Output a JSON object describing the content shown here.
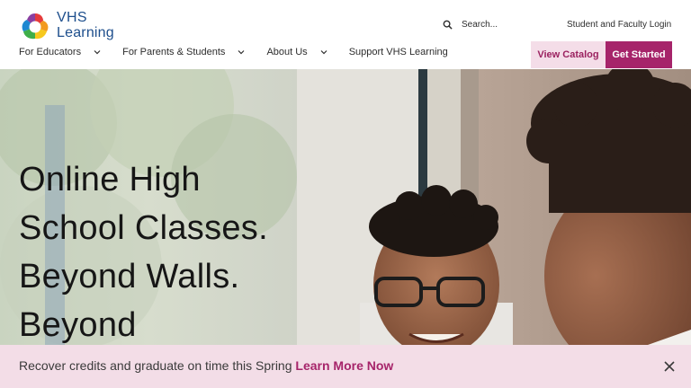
{
  "brand": {
    "name_line1": "VHS",
    "name_line2": "Learning",
    "colors": {
      "primary": "#1d4e8c",
      "accent": "#a6246a",
      "accent_light": "#f4dde8"
    }
  },
  "header": {
    "search_placeholder": "Search...",
    "search_icon": "search-icon",
    "login_label": "Student and Faculty Login",
    "nav": [
      {
        "label": "For Educators",
        "has_dropdown": true
      },
      {
        "label": "For Parents & Students",
        "has_dropdown": true
      },
      {
        "label": "About Us",
        "has_dropdown": true
      },
      {
        "label": "Support VHS Learning",
        "has_dropdown": false
      }
    ],
    "view_catalog_label": "View Catalog",
    "get_started_label": "Get Started"
  },
  "hero": {
    "heading_lines": [
      "Online High",
      "School Classes.",
      "Beyond Walls.",
      "Beyond"
    ]
  },
  "banner": {
    "text": "Recover credits and graduate on time this Spring ",
    "link_label": "Learn More Now",
    "close_icon": "close-icon"
  }
}
